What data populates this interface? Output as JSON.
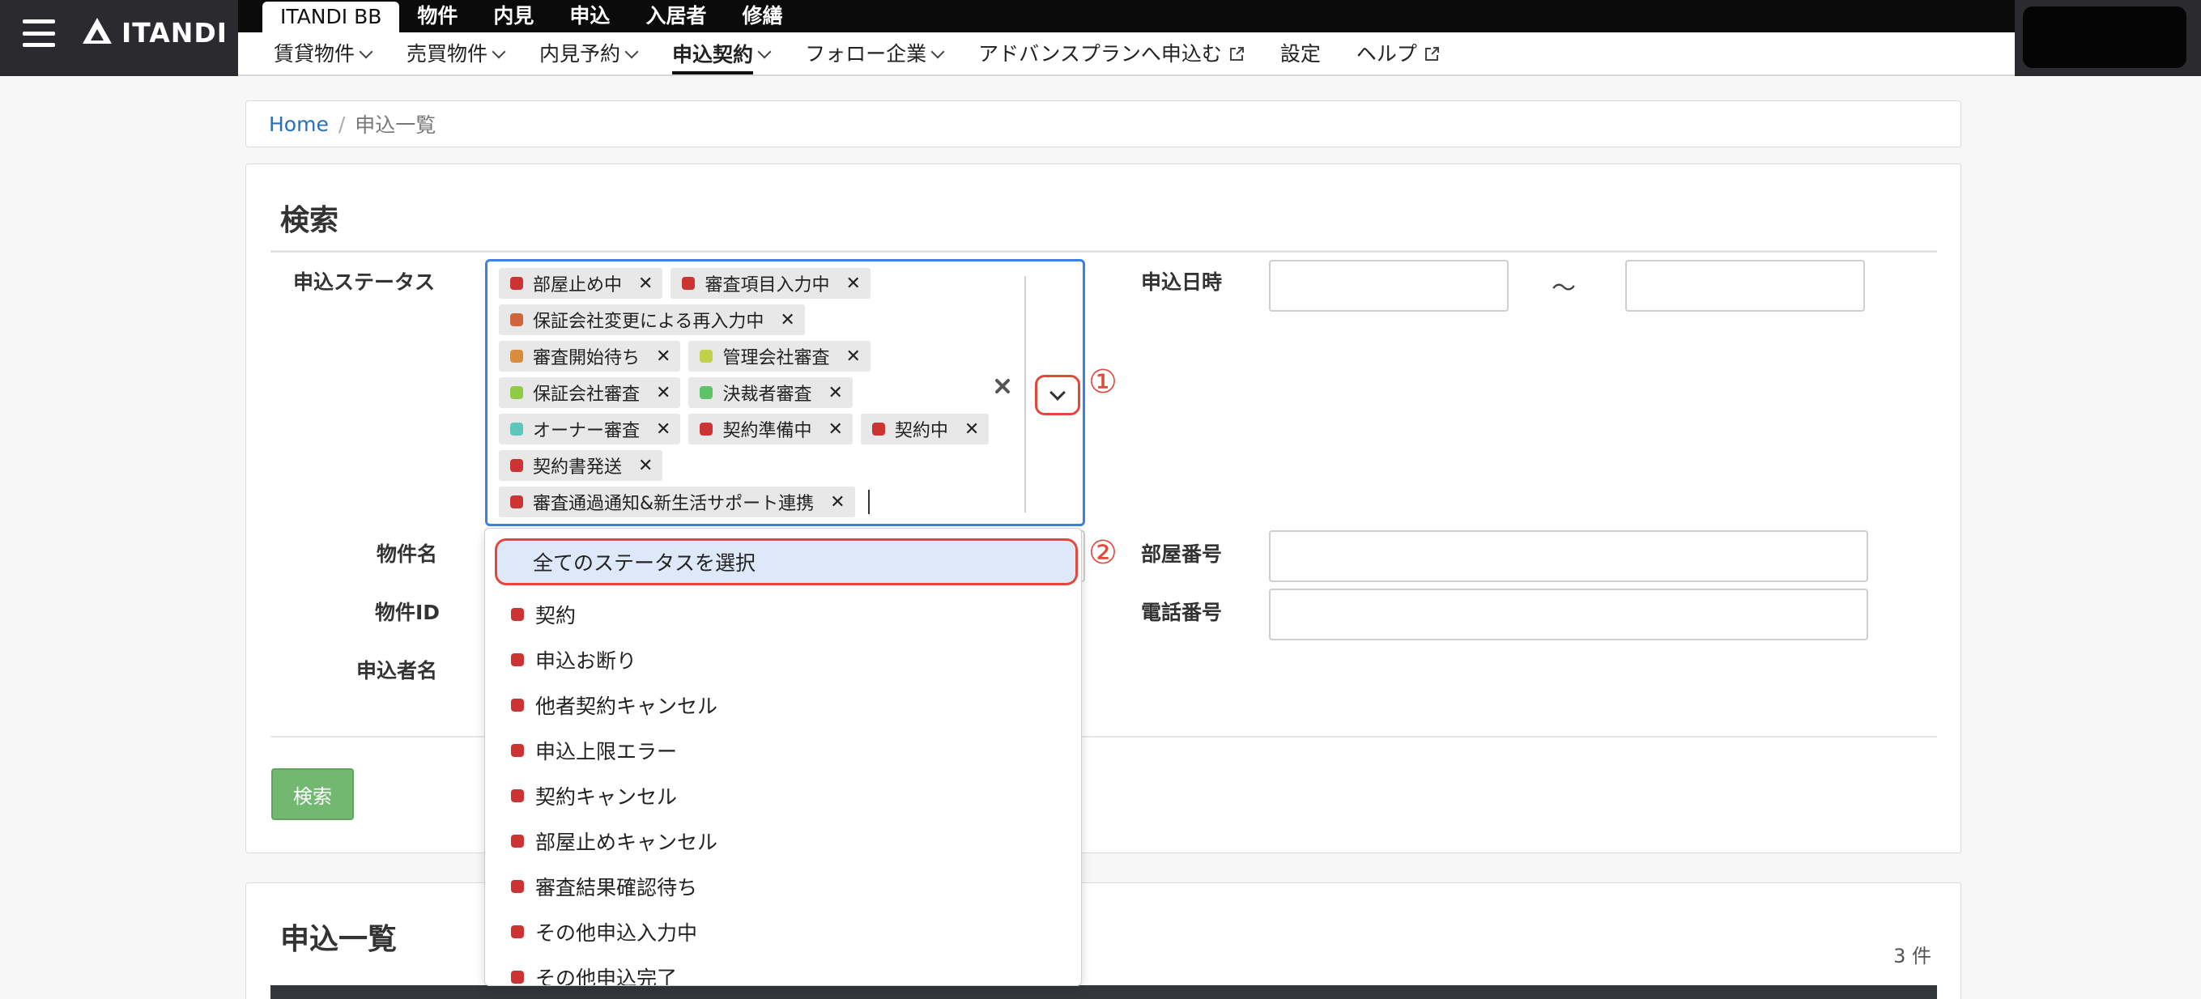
{
  "brand": {
    "name": "ITANDI"
  },
  "top_tabs": [
    "ITANDI BB",
    "物件",
    "内見",
    "申込",
    "入居者",
    "修繕"
  ],
  "sub_nav": [
    {
      "label": "賃貸物件",
      "chevron": true
    },
    {
      "label": "売買物件",
      "chevron": true
    },
    {
      "label": "内見予約",
      "chevron": true
    },
    {
      "label": "申込契約",
      "chevron": true,
      "active": true
    },
    {
      "label": "フォロー企業",
      "chevron": true
    },
    {
      "label": "アドバンスプランへ申込む",
      "external": true
    },
    {
      "label": "設定"
    },
    {
      "label": "ヘルプ",
      "external": true
    }
  ],
  "breadcrumb": {
    "home": "Home",
    "separator": "/",
    "current": "申込一覧"
  },
  "search": {
    "title": "検索",
    "status_label": "申込ステータス",
    "date_label": "申込日時",
    "date_separator": "～",
    "property_name_label": "物件名",
    "room_number_label": "部屋番号",
    "property_id_label": "物件ID",
    "phone_label": "電話番号",
    "applicant_label": "申込者名",
    "submit": "検索",
    "annotation_1": "①",
    "annotation_2": "②",
    "selected_statuses": [
      {
        "label": "部屋止め中",
        "color": "#cc3333"
      },
      {
        "label": "審査項目入力中",
        "color": "#cc3333"
      },
      {
        "label": "保証会社変更による再入力中",
        "color": "#d0643a"
      },
      {
        "label": "審査開始待ち",
        "color": "#d98c3a"
      },
      {
        "label": "管理会社審査",
        "color": "#c2d14a"
      },
      {
        "label": "保証会社審査",
        "color": "#8fcb45"
      },
      {
        "label": "決裁者審査",
        "color": "#5cc366"
      },
      {
        "label": "オーナー審査",
        "color": "#5cc6b8"
      },
      {
        "label": "契約準備中",
        "color": "#cc3333"
      },
      {
        "label": "契約中",
        "color": "#cc3333"
      },
      {
        "label": "契約書発送",
        "color": "#cc3333"
      },
      {
        "label": "審査通過通知&新生活サポート連携",
        "color": "#cc3333"
      }
    ]
  },
  "dropdown": {
    "select_all": "全てのステータスを選択",
    "options": [
      "契約",
      "申込お断り",
      "他者契約キャンセル",
      "申込上限エラー",
      "契約キャンセル",
      "部屋止めキャンセル",
      "審査結果確認待ち",
      "その他申込入力中",
      "その他申込完了"
    ]
  },
  "list": {
    "title": "申込一覧",
    "count": "3 件"
  }
}
